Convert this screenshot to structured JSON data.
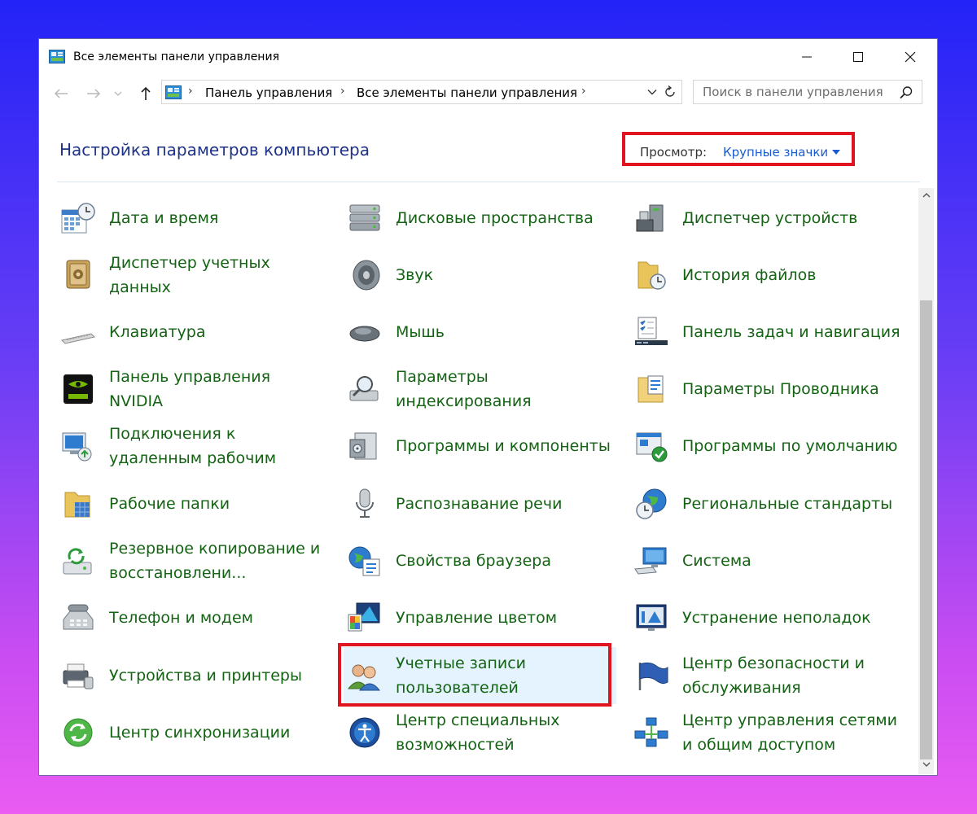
{
  "window": {
    "title": "Все элементы панели управления",
    "controls": {
      "minimize": "minimize-icon",
      "maximize": "maximize-icon",
      "close": "close-icon"
    }
  },
  "nav": {
    "back_icon": "arrow-left-icon",
    "forward_icon": "arrow-right-icon",
    "recent_icon": "chevron-down-icon",
    "up_icon": "arrow-up-icon",
    "breadcrumb": [
      "Панель управления",
      "Все элементы панели управления"
    ],
    "search_placeholder": "Поиск в панели управления"
  },
  "header": {
    "title": "Настройка параметров компьютера",
    "view_by_label": "Просмотр:",
    "view_by_value": "Крупные значки"
  },
  "colors": {
    "link_green": "#136313",
    "heading_blue": "#1e3287",
    "accent_blue": "#1a5ccf",
    "highlight_red": "#e0141e",
    "selection_bg": "#e5f3ff"
  },
  "items": [
    {
      "label": "Дата и время",
      "icon": "calendar-clock-icon"
    },
    {
      "label": "Дисковые пространства",
      "icon": "storage-spaces-icon"
    },
    {
      "label": "Диспетчер устройств",
      "icon": "device-manager-icon"
    },
    {
      "label": "Диспетчер учетных данных",
      "icon": "credential-vault-icon"
    },
    {
      "label": "Звук",
      "icon": "speaker-icon"
    },
    {
      "label": "История файлов",
      "icon": "file-history-icon"
    },
    {
      "label": "Клавиатура",
      "icon": "keyboard-icon"
    },
    {
      "label": "Мышь",
      "icon": "mouse-icon"
    },
    {
      "label": "Панель задач и навигация",
      "icon": "taskbar-icon"
    },
    {
      "label": "Панель управления NVIDIA",
      "icon": "nvidia-icon"
    },
    {
      "label": "Параметры индексирования",
      "icon": "indexing-icon"
    },
    {
      "label": "Параметры Проводника",
      "icon": "explorer-options-icon"
    },
    {
      "label": "Подключения к удаленным рабочим",
      "icon": "remote-desktop-icon"
    },
    {
      "label": "Программы и компоненты",
      "icon": "programs-icon"
    },
    {
      "label": "Программы по умолчанию",
      "icon": "default-programs-icon"
    },
    {
      "label": "Рабочие папки",
      "icon": "work-folders-icon"
    },
    {
      "label": "Распознавание речи",
      "icon": "microphone-icon"
    },
    {
      "label": "Региональные стандарты",
      "icon": "region-globe-icon"
    },
    {
      "label": "Резервное копирование и восстановлени...",
      "icon": "backup-restore-icon"
    },
    {
      "label": "Свойства браузера",
      "icon": "internet-options-icon"
    },
    {
      "label": "Система",
      "icon": "system-monitor-icon"
    },
    {
      "label": "Телефон и модем",
      "icon": "phone-modem-icon"
    },
    {
      "label": "Управление цветом",
      "icon": "color-management-icon"
    },
    {
      "label": "Устранение неполадок",
      "icon": "troubleshooting-icon"
    },
    {
      "label": "Устройства и принтеры",
      "icon": "printer-icon"
    },
    {
      "label": "Учетные записи пользователей",
      "icon": "user-accounts-icon",
      "highlighted": true
    },
    {
      "label": "Центр безопасности и обслуживания",
      "icon": "security-flag-icon"
    },
    {
      "label": "Центр синхронизации",
      "icon": "sync-center-icon"
    },
    {
      "label": "Центр специальных возможностей",
      "icon": "accessibility-icon"
    },
    {
      "label": "Центр управления сетями и общим доступом",
      "icon": "network-center-icon"
    }
  ]
}
